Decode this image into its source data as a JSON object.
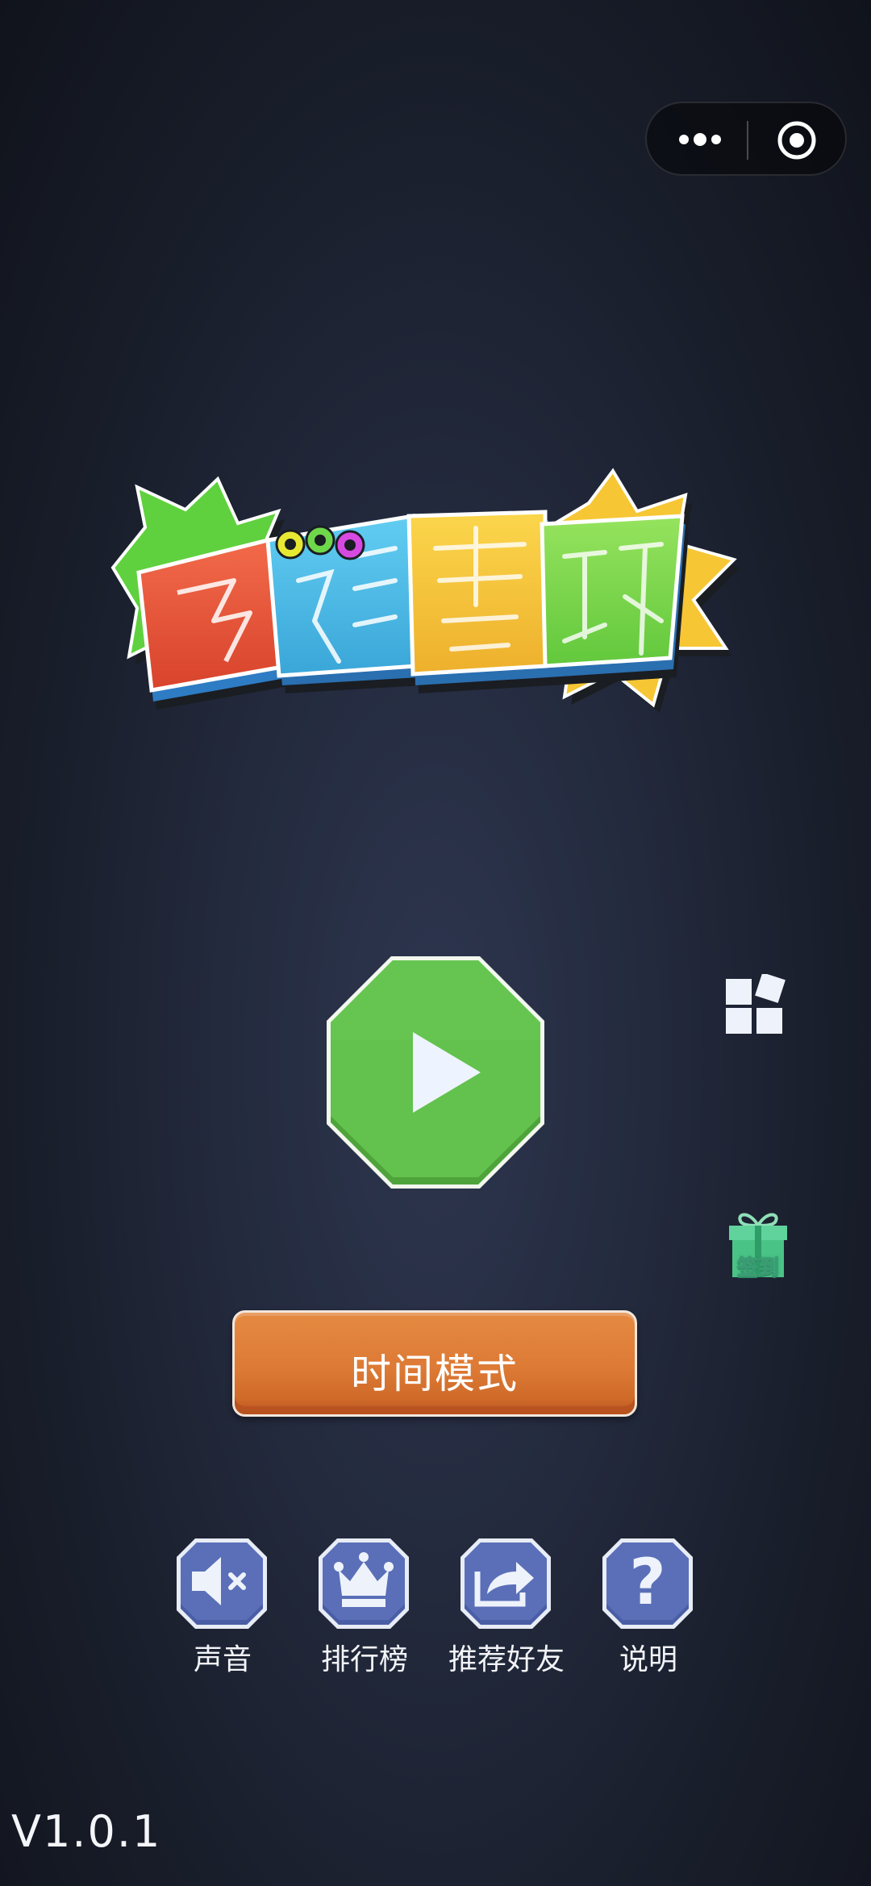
{
  "capsule": {
    "more_icon": "more-dots-icon",
    "close_icon": "target-circle-icon"
  },
  "logo": {
    "chars": [
      "多",
      "彩",
      "套",
      "环"
    ],
    "colors": [
      "#e8533a",
      "#45b9e6",
      "#f4c33a",
      "#7ed84a"
    ]
  },
  "play": {
    "icon": "play-icon",
    "color": "#5fbf4c"
  },
  "side": {
    "more_games_icon": "grid-squares-icon",
    "checkin_icon": "gift-icon",
    "checkin_label": "签到"
  },
  "time_mode": {
    "label": "时间模式",
    "color": "#dd7a35"
  },
  "menu": [
    {
      "label": "声音",
      "icon": "sound-mute-icon"
    },
    {
      "label": "排行榜",
      "icon": "crown-icon"
    },
    {
      "label": "推荐好友",
      "icon": "share-icon"
    },
    {
      "label": "说明",
      "icon": "question-icon"
    }
  ],
  "version": "V1.0.1",
  "colors": {
    "menu_tile": "#5a6fb8",
    "background": "#232a3d"
  }
}
